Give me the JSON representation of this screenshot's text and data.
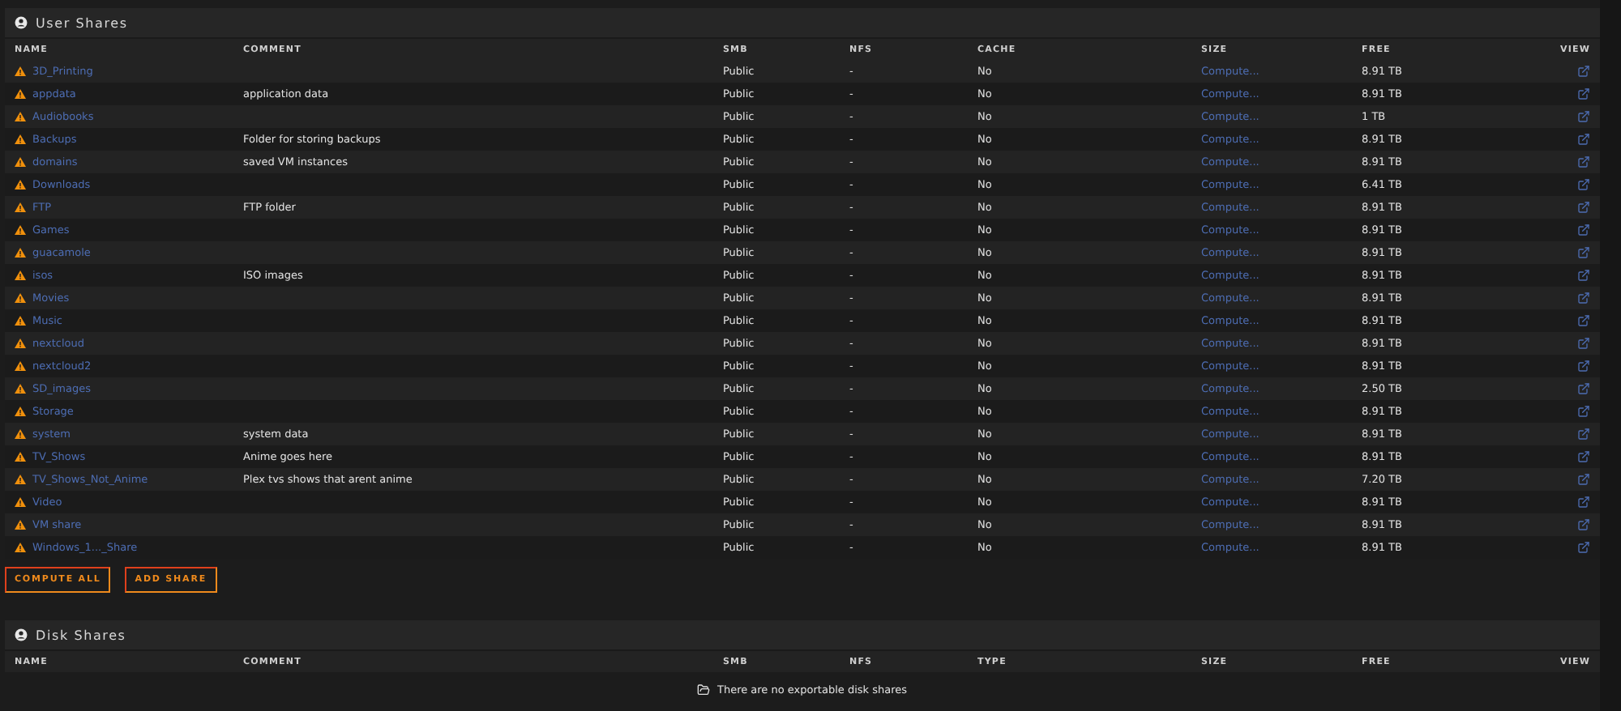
{
  "user_shares": {
    "title": "User Shares",
    "columns": [
      "NAME",
      "COMMENT",
      "SMB",
      "NFS",
      "CACHE",
      "SIZE",
      "FREE",
      "VIEW"
    ],
    "rows": [
      {
        "name": "3D_Printing",
        "comment": "",
        "smb": "Public",
        "nfs": "-",
        "cache": "No",
        "size": "Compute...",
        "free": "8.91 TB"
      },
      {
        "name": "appdata",
        "comment": "application data",
        "smb": "Public",
        "nfs": "-",
        "cache": "No",
        "size": "Compute...",
        "free": "8.91 TB"
      },
      {
        "name": "Audiobooks",
        "comment": "",
        "smb": "Public",
        "nfs": "-",
        "cache": "No",
        "size": "Compute...",
        "free": "1 TB"
      },
      {
        "name": "Backups",
        "comment": "Folder for storing backups",
        "smb": "Public",
        "nfs": "-",
        "cache": "No",
        "size": "Compute...",
        "free": "8.91 TB"
      },
      {
        "name": "domains",
        "comment": "saved VM instances",
        "smb": "Public",
        "nfs": "-",
        "cache": "No",
        "size": "Compute...",
        "free": "8.91 TB"
      },
      {
        "name": "Downloads",
        "comment": "",
        "smb": "Public",
        "nfs": "-",
        "cache": "No",
        "size": "Compute...",
        "free": "6.41 TB"
      },
      {
        "name": "FTP",
        "comment": "FTP folder",
        "smb": "Public",
        "nfs": "-",
        "cache": "No",
        "size": "Compute...",
        "free": "8.91 TB"
      },
      {
        "name": "Games",
        "comment": "",
        "smb": "Public",
        "nfs": "-",
        "cache": "No",
        "size": "Compute...",
        "free": "8.91 TB"
      },
      {
        "name": "guacamole",
        "comment": "",
        "smb": "Public",
        "nfs": "-",
        "cache": "No",
        "size": "Compute...",
        "free": "8.91 TB"
      },
      {
        "name": "isos",
        "comment": "ISO images",
        "smb": "Public",
        "nfs": "-",
        "cache": "No",
        "size": "Compute...",
        "free": "8.91 TB"
      },
      {
        "name": "Movies",
        "comment": "",
        "smb": "Public",
        "nfs": "-",
        "cache": "No",
        "size": "Compute...",
        "free": "8.91 TB"
      },
      {
        "name": "Music",
        "comment": "",
        "smb": "Public",
        "nfs": "-",
        "cache": "No",
        "size": "Compute...",
        "free": "8.91 TB"
      },
      {
        "name": "nextcloud",
        "comment": "",
        "smb": "Public",
        "nfs": "-",
        "cache": "No",
        "size": "Compute...",
        "free": "8.91 TB"
      },
      {
        "name": "nextcloud2",
        "comment": "",
        "smb": "Public",
        "nfs": "-",
        "cache": "No",
        "size": "Compute...",
        "free": "8.91 TB"
      },
      {
        "name": "SD_images",
        "comment": "",
        "smb": "Public",
        "nfs": "-",
        "cache": "No",
        "size": "Compute...",
        "free": "2.50 TB"
      },
      {
        "name": "Storage",
        "comment": "",
        "smb": "Public",
        "nfs": "-",
        "cache": "No",
        "size": "Compute...",
        "free": "8.91 TB"
      },
      {
        "name": "system",
        "comment": "system data",
        "smb": "Public",
        "nfs": "-",
        "cache": "No",
        "size": "Compute...",
        "free": "8.91 TB"
      },
      {
        "name": "TV_Shows",
        "comment": "Anime goes here",
        "smb": "Public",
        "nfs": "-",
        "cache": "No",
        "size": "Compute...",
        "free": "8.91 TB"
      },
      {
        "name": "TV_Shows_Not_Anime",
        "comment": "Plex tvs shows that arent anime",
        "smb": "Public",
        "nfs": "-",
        "cache": "No",
        "size": "Compute...",
        "free": "7.20 TB"
      },
      {
        "name": "Video",
        "comment": "",
        "smb": "Public",
        "nfs": "-",
        "cache": "No",
        "size": "Compute...",
        "free": "8.91 TB"
      },
      {
        "name": "VM share",
        "comment": "",
        "smb": "Public",
        "nfs": "-",
        "cache": "No",
        "size": "Compute...",
        "free": "8.91 TB"
      },
      {
        "name": "Windows_1..._Share",
        "comment": "",
        "smb": "Public",
        "nfs": "-",
        "cache": "No",
        "size": "Compute...",
        "free": "8.91 TB"
      }
    ],
    "buttons": [
      "COMPUTE ALL",
      "ADD SHARE"
    ]
  },
  "disk_shares": {
    "title": "Disk Shares",
    "columns": [
      "NAME",
      "COMMENT",
      "SMB",
      "NFS",
      "TYPE",
      "SIZE",
      "FREE",
      "VIEW"
    ],
    "empty_message": "There are no exportable disk shares"
  }
}
